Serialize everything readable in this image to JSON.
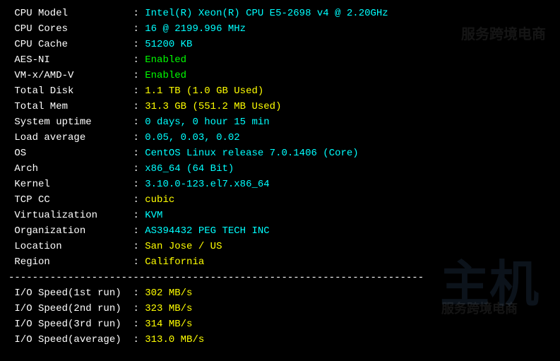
{
  "sysinfo": [
    {
      "label": "CPU Model",
      "value": "Intel(R) Xeon(R) CPU E5-2698 v4 @ 2.20GHz",
      "color": "cyan"
    },
    {
      "label": "CPU Cores",
      "value": "16 @ 2199.996 MHz",
      "color": "cyan"
    },
    {
      "label": "CPU Cache",
      "value": "51200 KB",
      "color": "cyan"
    },
    {
      "label": "AES-NI",
      "value": "Enabled",
      "color": "green"
    },
    {
      "label": "VM-x/AMD-V",
      "value": "Enabled",
      "color": "green"
    },
    {
      "label": "Total Disk",
      "value": "1.1 TB (1.0 GB Used)",
      "color": "yellow"
    },
    {
      "label": "Total Mem",
      "value": "31.3 GB (551.2 MB Used)",
      "color": "yellow"
    },
    {
      "label": "System uptime",
      "value": "0 days, 0 hour 15 min",
      "color": "cyan"
    },
    {
      "label": "Load average",
      "value": "0.05, 0.03, 0.02",
      "color": "cyan"
    },
    {
      "label": "OS",
      "value": "CentOS Linux release 7.0.1406 (Core)",
      "color": "cyan"
    },
    {
      "label": "Arch",
      "value": "x86_64 (64 Bit)",
      "color": "cyan"
    },
    {
      "label": "Kernel",
      "value": "3.10.0-123.el7.x86_64",
      "color": "cyan"
    },
    {
      "label": "TCP CC",
      "value": "cubic",
      "color": "yellow"
    },
    {
      "label": "Virtualization",
      "value": "KVM",
      "color": "cyan"
    },
    {
      "label": "Organization",
      "value": "AS394432 PEG TECH INC",
      "color": "cyan"
    },
    {
      "label": "Location",
      "value": "San Jose / US",
      "color": "yellow"
    },
    {
      "label": "Region",
      "value": "California",
      "color": "yellow"
    }
  ],
  "divider": "----------------------------------------------------------------------",
  "iospeed": [
    {
      "label": "I/O Speed(1st run)",
      "value": "302 MB/s",
      "color": "yellow"
    },
    {
      "label": "I/O Speed(2nd run)",
      "value": "323 MB/s",
      "color": "yellow"
    },
    {
      "label": "I/O Speed(3rd run)",
      "value": "314 MB/s",
      "color": "yellow"
    },
    {
      "label": "I/O Speed(average)",
      "value": "313.0 MB/s",
      "color": "yellow"
    }
  ],
  "label_width": 20
}
